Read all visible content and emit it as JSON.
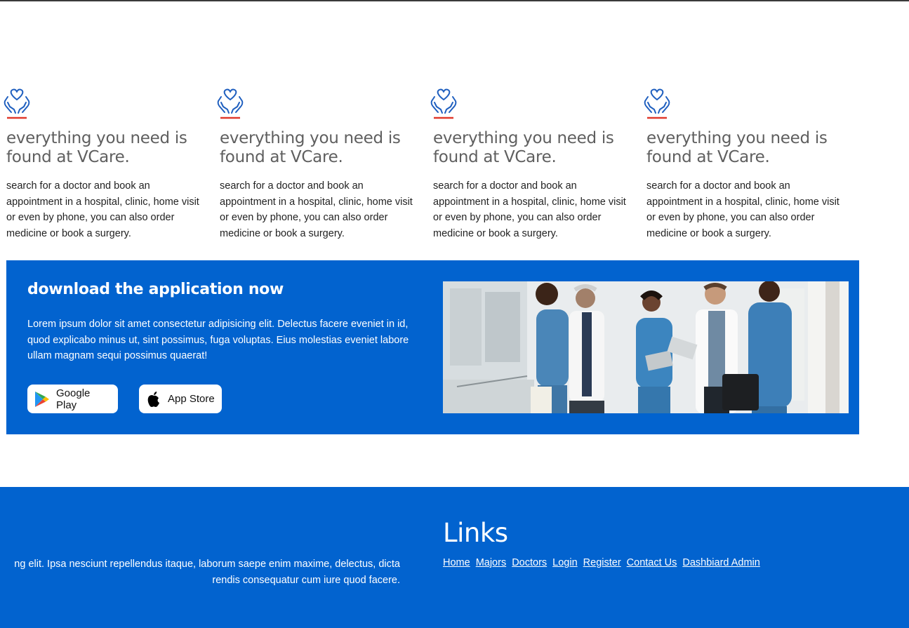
{
  "features": [
    {
      "title": "everything you need is found at VCare.",
      "text": "search for a doctor and book an appointment in a hospital, clinic, home visit or even by phone, you can also order medicine or book a surgery.",
      "icon": "hands-heart-icon"
    },
    {
      "title": "everything you need is found at VCare.",
      "text": "search for a doctor and book an appointment in a hospital, clinic, home visit or even by phone, you can also order medicine or book a surgery.",
      "icon": "hands-heart-icon"
    },
    {
      "title": "everything you need is found at VCare.",
      "text": "search for a doctor and book an appointment in a hospital, clinic, home visit or even by phone, you can also order medicine or book a surgery.",
      "icon": "hands-heart-icon"
    },
    {
      "title": "everything you need is found at VCare.",
      "text": "search for a doctor and book an appointment in a hospital, clinic, home visit or even by phone, you can also order medicine or book a surgery.",
      "icon": "hands-heart-icon"
    }
  ],
  "app_banner": {
    "title": "download the application now",
    "text": "Lorem ipsum dolor sit amet consectetur adipisicing elit. Delectus facere eveniet in id, quod explicabo minus ut, sint possimus, fuga voluptas. Eius molestias eveniet labore ullam magnam sequi possimus quaerat!",
    "google_play_label": "Google Play",
    "app_store_label": "App Store",
    "photo": "medical-team-photo"
  },
  "footer": {
    "text_line1": "ng elit. Ipsa nesciunt repellendus itaque, laborum saepe enim maxime, delectus, dicta",
    "text_line2": "rendis consequatur cum iure quod facere.",
    "links_title": "Links",
    "links": [
      "Home",
      "Majors",
      "Doctors",
      "Login",
      "Register",
      "Contact Us",
      "Dashbiard Admin"
    ]
  },
  "colors": {
    "brand_blue": "#0263cf",
    "icon_blue": "#1f5fbf",
    "icon_accent_red": "#e0392b",
    "heading_gray": "#5f5f5f"
  }
}
